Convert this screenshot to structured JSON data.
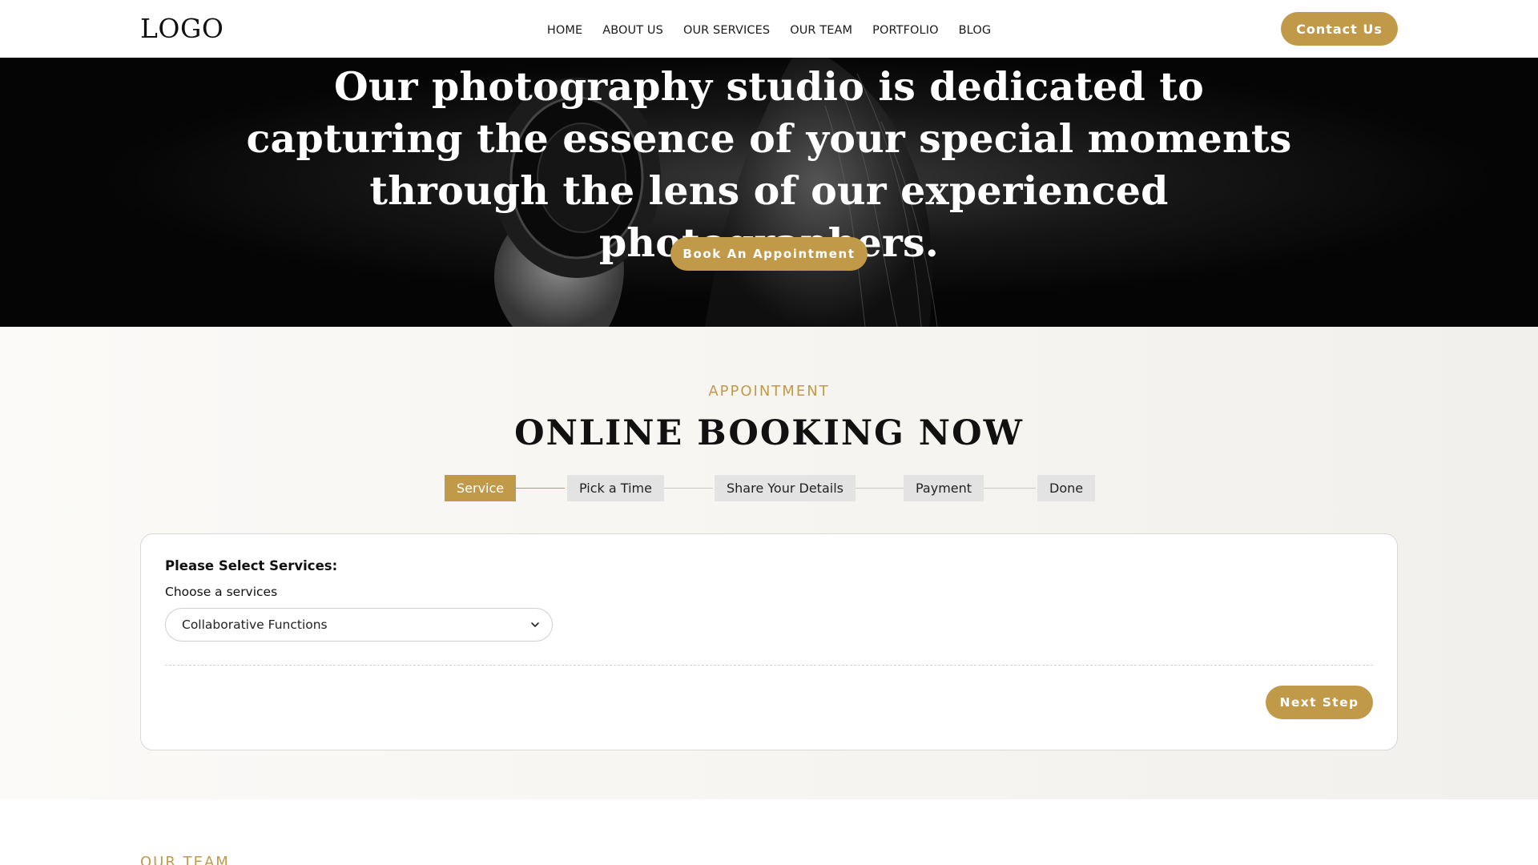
{
  "header": {
    "logo": "LOGO",
    "nav": [
      "HOME",
      "ABOUT US",
      "OUR SERVICES",
      "OUR TEAM",
      "PORTFOLIO",
      "BLOG"
    ],
    "contact_label": "Contact Us"
  },
  "hero": {
    "title": "Our photography studio is dedicated to capturing the essence of your special moments through the lens of our experienced photographers.",
    "button_label": "Book An Appointment"
  },
  "booking": {
    "eyebrow": "APPOINTMENT",
    "title": "ONLINE BOOKING NOW",
    "steps": [
      {
        "label": "Service",
        "active": true
      },
      {
        "label": "Pick a Time",
        "active": false
      },
      {
        "label": "Share Your Details",
        "active": false
      },
      {
        "label": "Payment",
        "active": false
      },
      {
        "label": "Done",
        "active": false
      }
    ],
    "card": {
      "heading": "Please Select Services:",
      "sublabel": "Choose a services",
      "selected_service": "Collaborative Functions",
      "next_label": "Next Step"
    }
  },
  "team": {
    "eyebrow": "OUR TEAM"
  },
  "colors": {
    "accent": "#c19a49",
    "hero_bg": "#050505",
    "step_inactive": "#e3e3e3"
  }
}
